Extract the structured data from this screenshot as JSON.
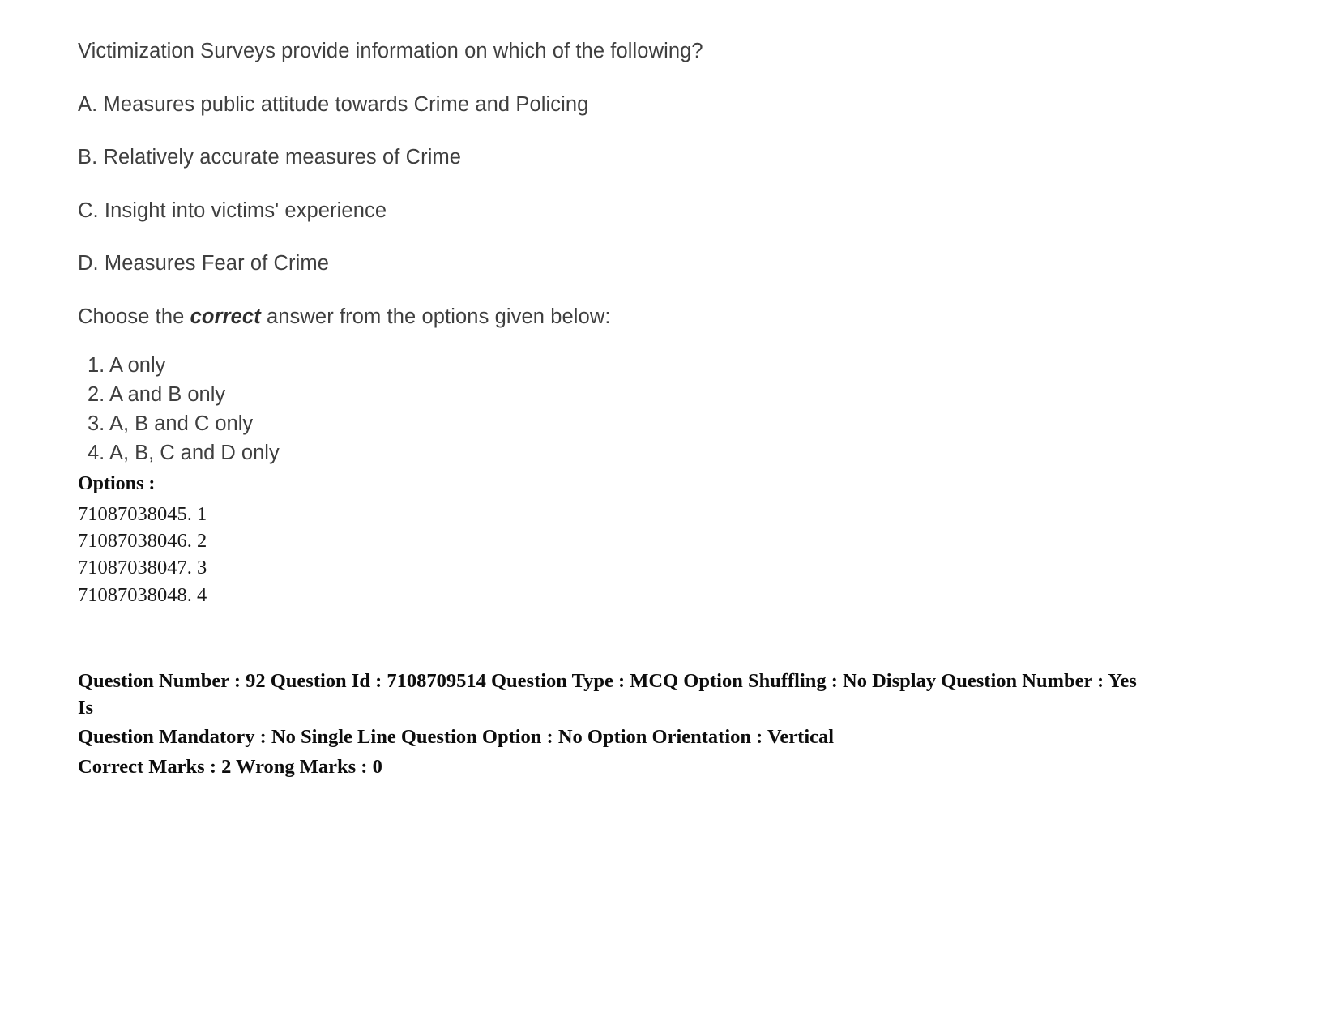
{
  "question": {
    "stem": "Victimization Surveys provide information on which of the following?",
    "statements": [
      "A. Measures public attitude towards Crime and Policing",
      "B. Relatively accurate measures of Crime",
      "C. Insight into victims' experience",
      "D. Measures Fear of Crime"
    ],
    "choose_prefix": "Choose the ",
    "choose_emphasis": "correct",
    "choose_suffix": " answer from the options given below:",
    "answers": [
      "1. A only",
      "2. A and B only",
      "3. A, B and C only",
      "4. A, B, C and D only"
    ]
  },
  "options_section": {
    "heading": "Options :",
    "items": [
      "71087038045. 1",
      "71087038046. 2",
      "71087038047. 3",
      "71087038048. 4"
    ]
  },
  "metadata": {
    "line1": "Question Number : 92 Question Id : 7108709514 Question Type : MCQ Option Shuffling : No Display Question Number : Yes Is",
    "line2": "Question Mandatory : No Single Line Question Option : No Option Orientation : Vertical",
    "line3": "Correct Marks : 2 Wrong Marks : 0",
    "question_number": "92",
    "question_id": "7108709514",
    "question_type": "MCQ",
    "option_shuffling": "No",
    "display_question_number": "Yes",
    "is_question_mandatory": "No",
    "single_line_question_option": "No",
    "option_orientation": "Vertical",
    "correct_marks": "2",
    "wrong_marks": "0"
  }
}
